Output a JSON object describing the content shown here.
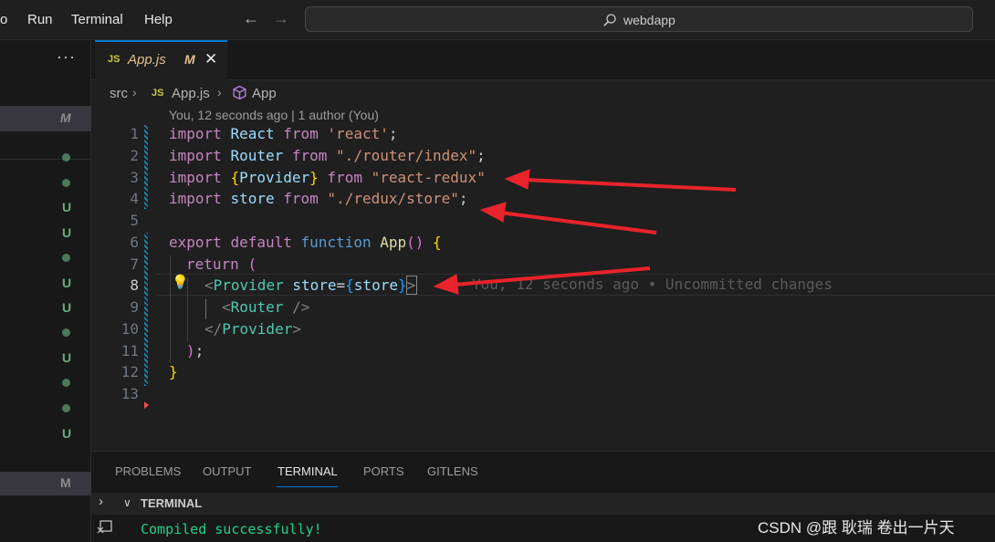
{
  "menu": {
    "partial": "o",
    "run": "Run",
    "terminal": "Terminal",
    "help": "Help"
  },
  "nav": {
    "back_icon": "arrow-left-icon",
    "forward_icon": "arrow-right-icon"
  },
  "search": {
    "text": "webdapp",
    "icon": "search-icon"
  },
  "sidebar": {
    "more": "···",
    "status_m": "M",
    "status_items": [
      "dot",
      "dot",
      "U",
      "U",
      "dot",
      "U",
      "U",
      "dot",
      "U",
      "dot",
      "U"
    ],
    "status_u": "U",
    "status_m2": "M"
  },
  "tab": {
    "lang": "JS",
    "name": "App.js",
    "modified": "M",
    "close_icon": "close-icon"
  },
  "breadcrumb": {
    "folder": "src",
    "file": "App.js",
    "lang": "JS",
    "symbol": "App",
    "symbol_icon": "cube-icon"
  },
  "editor": {
    "blame_header": "You, 12 seconds ago | 1 author (You)",
    "line_numbers": [
      "1",
      "2",
      "3",
      "4",
      "5",
      "6",
      "7",
      "8",
      "9",
      "10",
      "11",
      "12",
      "13"
    ],
    "active_line": "8",
    "inline_blame": "You, 12 seconds ago • Uncommitted changes",
    "lines": {
      "l1": {
        "kw1": "import",
        "id": "React",
        "kw2": "from",
        "str": "'react'",
        "end": ";"
      },
      "l2": {
        "kw1": "import",
        "id": "Router",
        "kw2": "from",
        "str": "\"./router/index\"",
        "end": ";"
      },
      "l3": {
        "kw1": "import",
        "open": "{",
        "id": "Provider",
        "close": "}",
        "kw2": "from",
        "str": "\"react-redux\""
      },
      "l4": {
        "kw1": "import",
        "id": "store",
        "kw2": "from",
        "str": "\"./redux/store\"",
        "end": ";"
      },
      "l6": {
        "kw1": "export",
        "kw2": "default",
        "kw3": "function",
        "fn": "App",
        "parens": "()",
        "brace": "{"
      },
      "l7": {
        "kw": "return",
        "paren": "("
      },
      "l8": {
        "lt": "<",
        "tag": "Provider",
        "attr": "store",
        "eq": "=",
        "open": "{",
        "val": "store",
        "close": "}",
        "gt": ">"
      },
      "l9": {
        "lt": "<",
        "tag": "Router",
        "end": " />"
      },
      "l10": {
        "lt": "</",
        "tag": "Provider",
        "gt": ">"
      },
      "l11": {
        "paren": ")",
        "end": ";"
      },
      "l12": {
        "brace": "}"
      }
    }
  },
  "panel": {
    "tabs": [
      "PROBLEMS",
      "OUTPUT",
      "TERMINAL",
      "PORTS",
      "GITLENS"
    ],
    "active_tab": "TERMINAL",
    "terminal_title": "TERMINAL",
    "output": "Compiled successfully!"
  },
  "watermark": "CSDN @跟 耿瑞 卷出一片天",
  "colors": {
    "accent": "#0078d4",
    "annotation_arrow": "#e8232b",
    "git_untracked": "#73c991",
    "git_modified": "#e2c08d"
  }
}
